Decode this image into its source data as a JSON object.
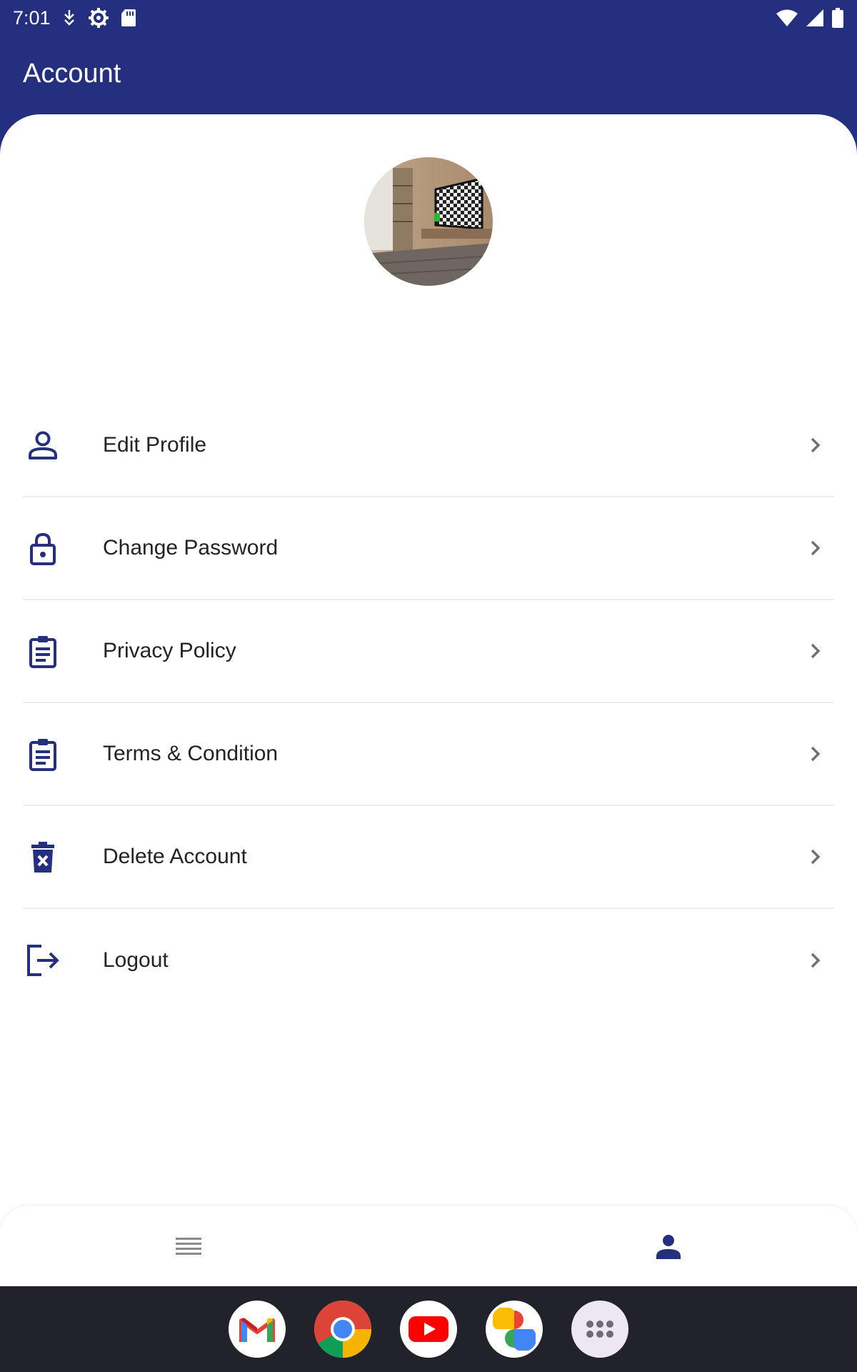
{
  "status_bar": {
    "time": "7:01",
    "left_icons": [
      "download-icon",
      "settings-gear-icon",
      "sd-card-icon"
    ],
    "right_icons": [
      "wifi-icon",
      "cell-signal-icon",
      "battery-icon"
    ]
  },
  "app_bar": {
    "title": "Account"
  },
  "profile": {
    "avatar": "profile-photo-living-room"
  },
  "menu": {
    "items": [
      {
        "label": "Edit Profile",
        "icon": "person-icon"
      },
      {
        "label": "Change Password",
        "icon": "lock-icon"
      },
      {
        "label": "Privacy Policy",
        "icon": "clipboard-icon"
      },
      {
        "label": "Terms & Condition",
        "icon": "clipboard-icon"
      },
      {
        "label": "Delete Account",
        "icon": "delete-bin-icon"
      },
      {
        "label": "Logout",
        "icon": "logout-icon"
      }
    ]
  },
  "bottom_nav": {
    "items": [
      {
        "icon": "list-menu-icon",
        "active": false
      },
      {
        "icon": "person-icon",
        "active": true
      }
    ]
  },
  "dock": {
    "apps": [
      "gmail-icon",
      "chrome-icon",
      "youtube-icon",
      "google-photos-icon",
      "app-launcher-icon"
    ]
  },
  "colors": {
    "primary": "#252F80",
    "text": "#22222A",
    "divider": "#EEEEF0",
    "chevron": "#707078",
    "inactive_nav": "#8A8A90",
    "dock_bg": "#21222A"
  }
}
